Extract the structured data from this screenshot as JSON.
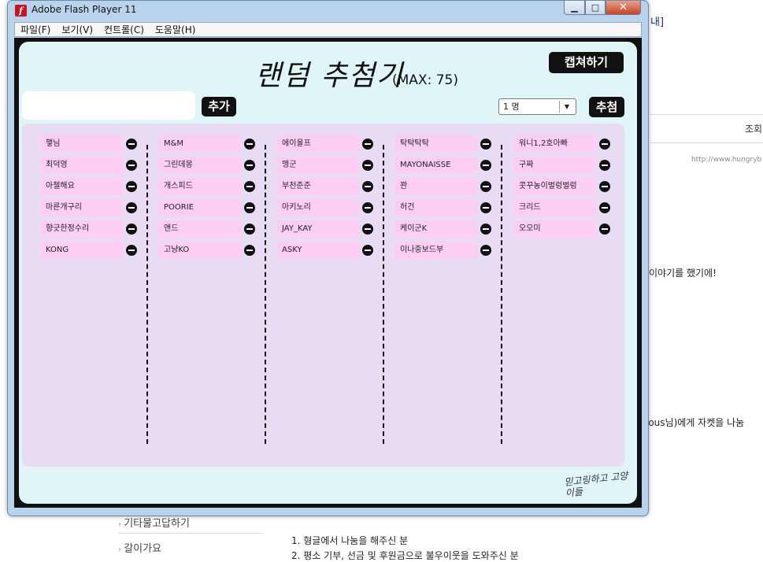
{
  "background": {
    "heading_fragment": "내]",
    "views_label": "조회",
    "url_fragment": "http://www.hungryb",
    "line1": "이야기를 했기에!",
    "line2": "lous님)에게 자켓을 나눔",
    "sidebar_items": [
      "기타물고답하기",
      "갈이가요"
    ],
    "list_lines": [
      "1. 형글에서 나눔을 해주신 분",
      "2. 평소 기부, 선금 및 후원금으로 불우이웃을 도와주신 분"
    ]
  },
  "window": {
    "title": "Adobe Flash Player 11",
    "minimize_glyph": "▁",
    "maximize_glyph": "□",
    "close_glyph": "✕",
    "menu": [
      "파일(F)",
      "보기(V)",
      "컨트롤(C)",
      "도움말(H)"
    ]
  },
  "app": {
    "title": "랜덤 추첨기",
    "max_label": "(MAX: 75)",
    "capture_label": "캡쳐하기",
    "add_label": "추가",
    "input_value": "",
    "count_selected": "1 명",
    "draw_label": "추첨",
    "logo_text": "믿고링하고 고양이들"
  },
  "columns": [
    [
      "햏님",
      "최덕영",
      "아첼해요",
      "마른개구리",
      "향긋한정수리",
      "KONG"
    ],
    [
      "M&M",
      "그린데몽",
      "개스피드",
      "POORIE",
      "앤드",
      "고냥KO"
    ],
    [
      "에이울프",
      "맹군",
      "부천준준",
      "아키노리",
      "JAY_KAY",
      "ASKY"
    ],
    [
      "탁탁탁탁",
      "MAYONAISSE",
      "꽌",
      "허건",
      "케이군K",
      "이나중보드부"
    ],
    [
      "워니1,2호아빠",
      "구짜",
      "콧꾸농이벌렁벌렁",
      "크리드",
      "오오미"
    ]
  ]
}
